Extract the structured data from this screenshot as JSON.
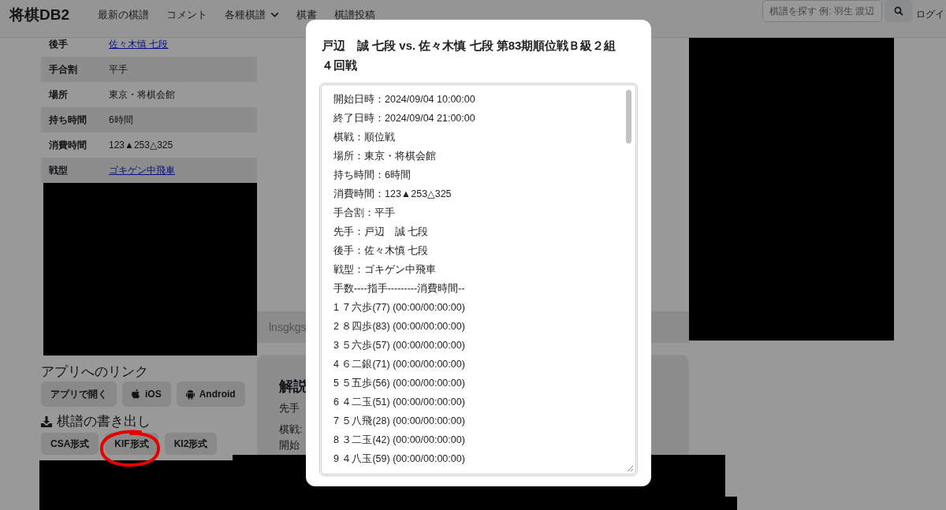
{
  "navbar": {
    "brand": "将棋DB2",
    "links": [
      {
        "label": "最新の棋譜",
        "kind": "link"
      },
      {
        "label": "コメント",
        "kind": "link"
      },
      {
        "label": "各種棋譜",
        "kind": "dropdown"
      },
      {
        "label": "棋書",
        "kind": "link"
      },
      {
        "label": "棋譜投稿",
        "kind": "link"
      }
    ],
    "search": {
      "placeholder": "棋譜を探す 例: 羽生 渡辺"
    },
    "login": "ログイ"
  },
  "game_info": {
    "rows": [
      {
        "label": "後手",
        "value": "佐々木慎 七段",
        "kind": "link"
      },
      {
        "label": "手合割",
        "value": "平手",
        "kind": "text"
      },
      {
        "label": "場所",
        "value": "東京・将棋会館",
        "kind": "text"
      },
      {
        "label": "持ち時間",
        "value": "6時間",
        "kind": "text"
      },
      {
        "label": "消費時間",
        "value": "123▲253△325",
        "kind": "text"
      },
      {
        "label": "戦型",
        "value": "ゴキゲン中飛車",
        "kind": "link"
      }
    ]
  },
  "app_links": {
    "title": "アプリへのリンク",
    "buttons": [
      {
        "label": "アプリで開く",
        "kind": "plain"
      },
      {
        "label": "iOS",
        "kind": "apple"
      },
      {
        "label": "Android",
        "kind": "android"
      }
    ]
  },
  "export": {
    "title": "棋譜の書き出し",
    "buttons": [
      {
        "label": "CSA形式",
        "circled": false
      },
      {
        "label": "KIF形式",
        "circled": true
      },
      {
        "label": "KI2形式",
        "circled": false
      }
    ]
  },
  "comment_bar": {
    "text": "lnsgkgs"
  },
  "commentary_card": {
    "title": "解説",
    "lines": [
      "先手",
      "棋戦:",
      "開始"
    ]
  },
  "modal": {
    "title": "戸辺　誠 七段 vs. 佐々木慎 七段 第83期順位戦Ｂ級２組４回戦",
    "kif_lines": [
      "開始日時：2024/09/04 10:00:00",
      "終了日時：2024/09/04 21:00:00",
      "棋戦：順位戦",
      "場所：東京・将棋会館",
      "持ち時間：6時間",
      "消費時間：123▲253△325",
      "手合割：平手",
      "先手：戸辺　誠 七段",
      "後手：佐々木慎 七段",
      "戦型：ゴキゲン中飛車",
      "手数----指手---------消費時間--",
      "1 ７六歩(77) (00:00/00:00:00)",
      "2 ８四歩(83) (00:00/00:00:00)",
      "3 ５六歩(57) (00:00/00:00:00)",
      "4 ６二銀(71) (00:00/00:00:00)",
      "5 ５五歩(56) (00:00/00:00:00)",
      "6 ４二玉(51) (00:00/00:00:00)",
      "7 ５八飛(28) (00:00/00:00:00)",
      "8 ３二玉(42) (00:00/00:00:00)",
      "9 ４八玉(59) (00:00/00:00:00)"
    ]
  }
}
